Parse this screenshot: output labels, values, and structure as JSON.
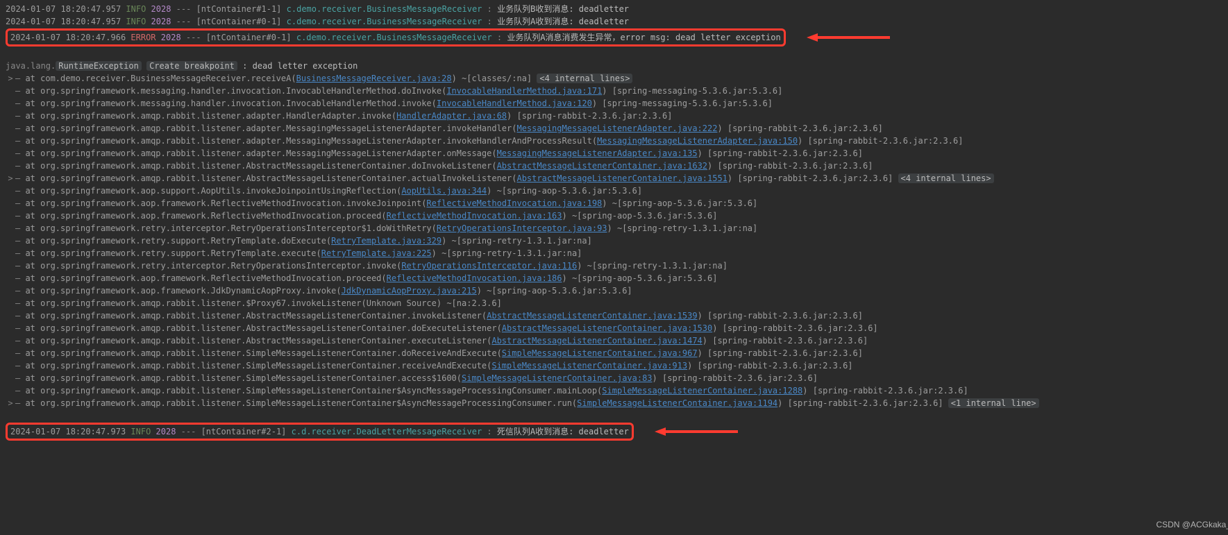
{
  "arrow_color": "#ff3b30",
  "log": [
    {
      "ts": "2024-01-07 18:20:47.957",
      "lvl": "INFO",
      "pid": "2028",
      "thr": "[ntContainer#1-1]",
      "cls": "c.demo.receiver.BusinessMessageReceiver",
      "msg": "业务队列B收到消息: deadletter",
      "boxed": false
    },
    {
      "ts": "2024-01-07 18:20:47.957",
      "lvl": "INFO",
      "pid": "2028",
      "thr": "[ntContainer#0-1]",
      "cls": "c.demo.receiver.BusinessMessageReceiver",
      "msg": "业务队列A收到消息: deadletter",
      "boxed": false
    },
    {
      "ts": "2024-01-07 18:20:47.966",
      "lvl": "ERROR",
      "pid": "2028",
      "thr": "[ntContainer#0-1]",
      "cls": "c.demo.receiver.BusinessMessageReceiver",
      "msg": "业务队列A消息消费发生异常，error msg: dead letter exception",
      "boxed": true,
      "arrow": true
    }
  ],
  "exception": {
    "head": "java.lang.",
    "runtime": "RuntimeException",
    "breakpoint": "Create breakpoint",
    "tail": ": dead letter exception"
  },
  "stack": [
    {
      "top": true,
      "txt": "at com.demo.receiver.BusinessMessageReceiver.receiveA(",
      "link": "BusinessMessageReceiver.java:28",
      "post": ") ~[classes/:na] ",
      "badge": "<4 internal lines>"
    },
    {
      "txt": "at org.springframework.messaging.handler.invocation.InvocableHandlerMethod.doInvoke(",
      "link": "InvocableHandlerMethod.java:171",
      "post": ") [spring-messaging-5.3.6.jar:5.3.6]"
    },
    {
      "txt": "at org.springframework.messaging.handler.invocation.InvocableHandlerMethod.invoke(",
      "link": "InvocableHandlerMethod.java:120",
      "post": ") [spring-messaging-5.3.6.jar:5.3.6]"
    },
    {
      "txt": "at org.springframework.amqp.rabbit.listener.adapter.HandlerAdapter.invoke(",
      "link": "HandlerAdapter.java:68",
      "post": ") [spring-rabbit-2.3.6.jar:2.3.6]"
    },
    {
      "txt": "at org.springframework.amqp.rabbit.listener.adapter.MessagingMessageListenerAdapter.invokeHandler(",
      "link": "MessagingMessageListenerAdapter.java:222",
      "post": ") [spring-rabbit-2.3.6.jar:2.3.6]"
    },
    {
      "txt": "at org.springframework.amqp.rabbit.listener.adapter.MessagingMessageListenerAdapter.invokeHandlerAndProcessResult(",
      "link": "MessagingMessageListenerAdapter.java:150",
      "post": ") [spring-rabbit-2.3.6.jar:2.3.6]"
    },
    {
      "txt": "at org.springframework.amqp.rabbit.listener.adapter.MessagingMessageListenerAdapter.onMessage(",
      "link": "MessagingMessageListenerAdapter.java:135",
      "post": ") [spring-rabbit-2.3.6.jar:2.3.6]"
    },
    {
      "txt": "at org.springframework.amqp.rabbit.listener.AbstractMessageListenerContainer.doInvokeListener(",
      "link": "AbstractMessageListenerContainer.java:1632",
      "post": ") [spring-rabbit-2.3.6.jar:2.3.6]"
    },
    {
      "top": true,
      "txt": "at org.springframework.amqp.rabbit.listener.AbstractMessageListenerContainer.actualInvokeListener(",
      "link": "AbstractMessageListenerContainer.java:1551",
      "post": ") [spring-rabbit-2.3.6.jar:2.3.6] ",
      "badge": "<4 internal lines>"
    },
    {
      "txt": "at org.springframework.aop.support.AopUtils.invokeJoinpointUsingReflection(",
      "link": "AopUtils.java:344",
      "post": ") ~[spring-aop-5.3.6.jar:5.3.6]"
    },
    {
      "txt": "at org.springframework.aop.framework.ReflectiveMethodInvocation.invokeJoinpoint(",
      "link": "ReflectiveMethodInvocation.java:198",
      "post": ") ~[spring-aop-5.3.6.jar:5.3.6]"
    },
    {
      "txt": "at org.springframework.aop.framework.ReflectiveMethodInvocation.proceed(",
      "link": "ReflectiveMethodInvocation.java:163",
      "post": ") ~[spring-aop-5.3.6.jar:5.3.6]"
    },
    {
      "txt": "at org.springframework.retry.interceptor.RetryOperationsInterceptor$1.doWithRetry(",
      "link": "RetryOperationsInterceptor.java:93",
      "post": ") ~[spring-retry-1.3.1.jar:na]"
    },
    {
      "txt": "at org.springframework.retry.support.RetryTemplate.doExecute(",
      "link": "RetryTemplate.java:329",
      "post": ") ~[spring-retry-1.3.1.jar:na]"
    },
    {
      "txt": "at org.springframework.retry.support.RetryTemplate.execute(",
      "link": "RetryTemplate.java:225",
      "post": ") ~[spring-retry-1.3.1.jar:na]"
    },
    {
      "txt": "at org.springframework.retry.interceptor.RetryOperationsInterceptor.invoke(",
      "link": "RetryOperationsInterceptor.java:116",
      "post": ") ~[spring-retry-1.3.1.jar:na]"
    },
    {
      "txt": "at org.springframework.aop.framework.ReflectiveMethodInvocation.proceed(",
      "link": "ReflectiveMethodInvocation.java:186",
      "post": ") ~[spring-aop-5.3.6.jar:5.3.6]"
    },
    {
      "txt": "at org.springframework.aop.framework.JdkDynamicAopProxy.invoke(",
      "link": "JdkDynamicAopProxy.java:215",
      "post": ") ~[spring-aop-5.3.6.jar:5.3.6]"
    },
    {
      "txt": "at org.springframework.amqp.rabbit.listener.$Proxy67.invokeListener(Unknown Source)",
      "link": null,
      "post": " ~[na:2.3.6]"
    },
    {
      "txt": "at org.springframework.amqp.rabbit.listener.AbstractMessageListenerContainer.invokeListener(",
      "link": "AbstractMessageListenerContainer.java:1539",
      "post": ") [spring-rabbit-2.3.6.jar:2.3.6]"
    },
    {
      "txt": "at org.springframework.amqp.rabbit.listener.AbstractMessageListenerContainer.doExecuteListener(",
      "link": "AbstractMessageListenerContainer.java:1530",
      "post": ") [spring-rabbit-2.3.6.jar:2.3.6]"
    },
    {
      "txt": "at org.springframework.amqp.rabbit.listener.AbstractMessageListenerContainer.executeListener(",
      "link": "AbstractMessageListenerContainer.java:1474",
      "post": ") [spring-rabbit-2.3.6.jar:2.3.6]"
    },
    {
      "txt": "at org.springframework.amqp.rabbit.listener.SimpleMessageListenerContainer.doReceiveAndExecute(",
      "link": "SimpleMessageListenerContainer.java:967",
      "post": ") [spring-rabbit-2.3.6.jar:2.3.6]"
    },
    {
      "txt": "at org.springframework.amqp.rabbit.listener.SimpleMessageListenerContainer.receiveAndExecute(",
      "link": "SimpleMessageListenerContainer.java:913",
      "post": ") [spring-rabbit-2.3.6.jar:2.3.6]"
    },
    {
      "txt": "at org.springframework.amqp.rabbit.listener.SimpleMessageListenerContainer.access$1600(",
      "link": "SimpleMessageListenerContainer.java:83",
      "post": ") [spring-rabbit-2.3.6.jar:2.3.6]"
    },
    {
      "txt": "at org.springframework.amqp.rabbit.listener.SimpleMessageListenerContainer$AsyncMessageProcessingConsumer.mainLoop(",
      "link": "SimpleMessageListenerContainer.java:1288",
      "post": ") [spring-rabbit-2.3.6.jar:2.3.6]"
    },
    {
      "top": true,
      "txt": "at org.springframework.amqp.rabbit.listener.SimpleMessageListenerContainer$AsyncMessageProcessingConsumer.run(",
      "link": "SimpleMessageListenerContainer.java:1194",
      "post": ") [spring-rabbit-2.3.6.jar:2.3.6] ",
      "badge": "<1 internal line>"
    }
  ],
  "tail": {
    "ts": "2024-01-07 18:20:47.973",
    "lvl": "INFO",
    "pid": "2028",
    "thr": "[ntContainer#2-1]",
    "cls": "c.d.receiver.DeadLetterMessageReceiver",
    "msg": "死信队列A收到消息: deadletter"
  },
  "watermark": "CSDN @ACGkaka_"
}
